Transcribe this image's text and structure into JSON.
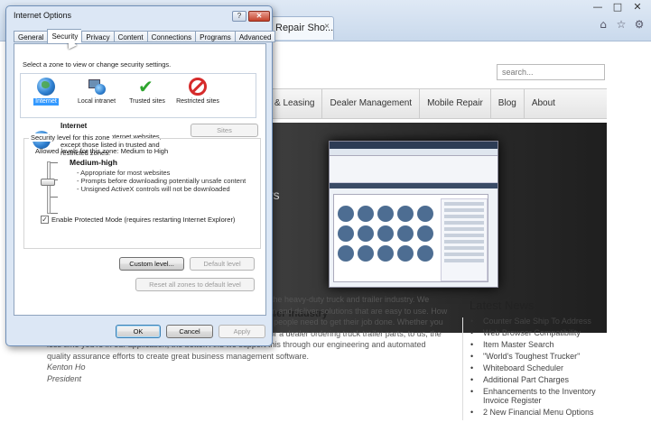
{
  "browser": {
    "tab_title": "Repair Sho...",
    "tab_close": "×",
    "window_buttons": [
      "—",
      "□",
      "✕"
    ],
    "toolbar_icons": [
      "home-icon",
      "star-icon",
      "gear-icon"
    ]
  },
  "site": {
    "search_placeholder": "search...",
    "nav": [
      "& Leasing",
      "Dealer Management",
      "Mobile Repair",
      "Blog",
      "About"
    ],
    "hero_partial_text": "rs",
    "industry_heading": "iler Industry",
    "body_lines": [
      "the heavy-duty truck and trailer industry. We",
      "spend a lot of time working closely with our customers to design and deliver solutions that are easy to use. How",
      "we do this is by counting the clicks and reducing the steps that people need to get their job done. Whether you",
      "are a truck repair shop working on preventative maintenance, or a dealer ordering truck trailer parts, to us, the",
      "less time you're in our application, the better. And we support this through our engineering and automated",
      "quality assurance efforts to create great business management software."
    ],
    "signature_name": "Kenton Ho",
    "signature_title": "President",
    "news_title": "Latest News",
    "news": [
      "Counter Sale Ship To Address",
      "Web Browser Compatibility",
      "Item Master Search",
      "\"World's Toughest Trucker\"",
      "Whiteboard Scheduler",
      "Additional Part Charges",
      "Enhancements to the Inventory Invoice Register",
      "2 New Financial Menu Options"
    ]
  },
  "dialog": {
    "title": "Internet Options",
    "help": "?",
    "close": "✕",
    "tabs": [
      "General",
      "Security",
      "Privacy",
      "Content",
      "Connections",
      "Programs",
      "Advanced"
    ],
    "active_tab": "Security",
    "instruction": "Select a zone to view or change security settings.",
    "zones": [
      {
        "label": "Internet",
        "icon": "globe-icon"
      },
      {
        "label": "Local intranet",
        "icon": "intranet-icon"
      },
      {
        "label": "Trusted sites",
        "icon": "checkmark-icon"
      },
      {
        "label": "Restricted sites",
        "icon": "restricted-icon"
      }
    ],
    "selected_zone": "Internet",
    "zone_heading": "Internet",
    "zone_description": "This zone is for Internet websites, except those listed in trusted and restricted zones.",
    "sites_button": "Sites",
    "security_level_legend": "Security level for this zone",
    "allowed_levels": "Allowed levels for this zone: Medium to High",
    "level_name": "Medium-high",
    "level_points": [
      "- Appropriate for most websites",
      "- Prompts before downloading potentially unsafe content",
      "- Unsigned ActiveX controls will not be downloaded"
    ],
    "protected_mode_label": "Enable Protected Mode (requires restarting Internet Explorer)",
    "protected_mode_checked": "✓",
    "custom_level_button": "Custom level...",
    "default_level_button": "Default level",
    "reset_all_button": "Reset all zones to default level",
    "ok_button": "OK",
    "cancel_button": "Cancel",
    "apply_button": "Apply"
  }
}
